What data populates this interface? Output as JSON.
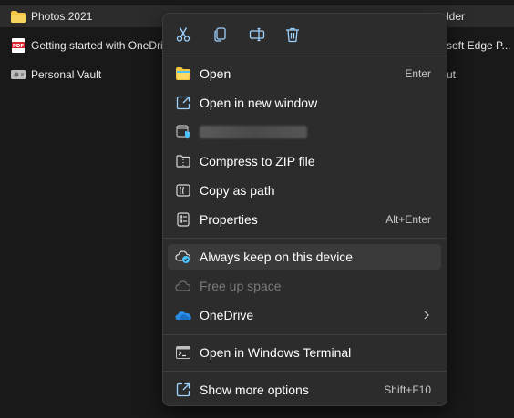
{
  "files": [
    {
      "name": "Photos 2021",
      "extra": "lder",
      "icon": "folder-icon",
      "selected": true
    },
    {
      "name": "Getting started with OneDriv",
      "extra": "soft Edge P...",
      "icon": "pdf-icon",
      "icon_text": "PDF"
    },
    {
      "name": "Personal Vault",
      "extra": "ut",
      "icon": "vault-icon"
    }
  ],
  "menu": {
    "toolbar": [
      "cut-icon",
      "copy-icon",
      "rename-icon",
      "delete-icon"
    ],
    "items": [
      {
        "label": "Open",
        "shortcut": "Enter",
        "icon": "folder-open-icon"
      },
      {
        "label": "Open in new window",
        "icon": "open-new-window-icon"
      },
      {
        "label": "",
        "icon": "shield-folder-icon",
        "redacted": true
      },
      {
        "label": "Compress to ZIP file",
        "icon": "zip-icon"
      },
      {
        "label": "Copy as path",
        "icon": "copy-path-icon"
      },
      {
        "label": "Properties",
        "shortcut": "Alt+Enter",
        "icon": "properties-icon"
      },
      {
        "label": "Always keep on this device",
        "icon": "cloud-keep-icon"
      },
      {
        "label": "Free up space",
        "icon": "cloud-outline-icon",
        "disabled": true
      },
      {
        "label": "OneDrive",
        "icon": "onedrive-icon",
        "submenu": true
      },
      {
        "label": "Open in Windows Terminal",
        "icon": "terminal-icon"
      },
      {
        "label": "Show more options",
        "shortcut": "Shift+F10",
        "icon": "more-options-icon"
      }
    ]
  },
  "colors": {
    "background": "#191919",
    "menu": "#2c2c2c",
    "folder": "#f4c542",
    "accent": "#4cc2ff",
    "onedrive": "#2d8ee8"
  }
}
